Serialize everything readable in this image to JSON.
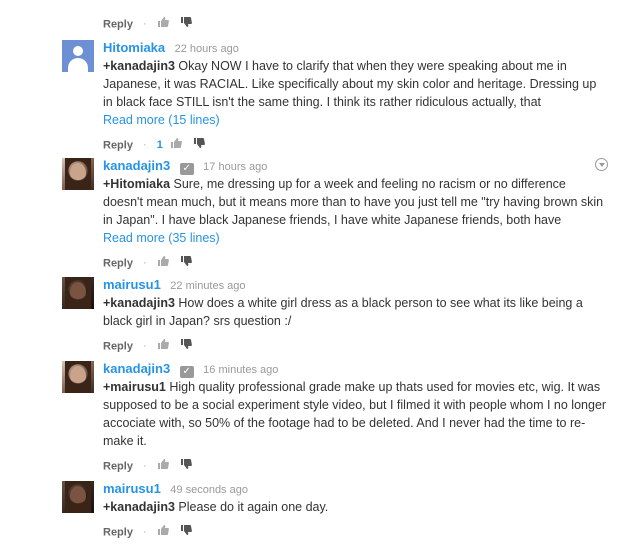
{
  "labels": {
    "reply": "Reply",
    "separator": "·"
  },
  "top": {
    "reply": "Reply"
  },
  "comments": [
    {
      "author": "Hitomiaka",
      "time": "22 hours ago",
      "mention": "+kanadajin3",
      "text": " Okay NOW I have to clarify that when they were speaking about me in Japanese, it was RACIAL. Like specifically about my skin color and heritage. Dressing up in black face STILL isn't the same thing. I think its rather ridiculous actually, that",
      "read_more": "Read more (15 lines)",
      "likes": "1",
      "avatar": "default-user-icon"
    },
    {
      "author": "kanadajin3",
      "time": "17 hours ago",
      "mention": "+Hitomiaka",
      "text": " Sure, me dressing up for a week and feeling no racism or no difference doesn't mean much, but it means more than to have you just tell me \"try having brown skin in Japan\". I have black Japanese friends, I have white Japanese friends, both have",
      "read_more": "Read more (35 lines)",
      "avatar": "photo"
    },
    {
      "author": "mairusu1",
      "time": "22 minutes ago",
      "mention": "+kanadajin3",
      "text": " How does a white girl dress as a black person to see what its like being a black girl in Japan? srs question :/",
      "avatar": "photo-dark"
    },
    {
      "author": "kanadajin3",
      "time": "16 minutes ago",
      "mention": "+mairusu1",
      "text": " High quality professional grade make up thats used for movies etc, wig.  It was supposed to be a social experiment style video, but I filmed it with people whom I no longer accociate with, so 50% of the footage had to be deleted. And I never had the time to re-make it.",
      "avatar": "photo"
    },
    {
      "author": "mairusu1",
      "time": "49 seconds ago",
      "mention": "+kanadajin3",
      "text": " Please do it again one day.",
      "avatar": "photo-dark"
    }
  ],
  "colors": {
    "link": "#2793e6",
    "meta": "#999999",
    "text": "#333333"
  },
  "icons": {
    "like": "thumbs-up-icon",
    "dislike": "thumbs-down-icon",
    "verified": "check-icon",
    "menu": "chevron-down-icon"
  }
}
